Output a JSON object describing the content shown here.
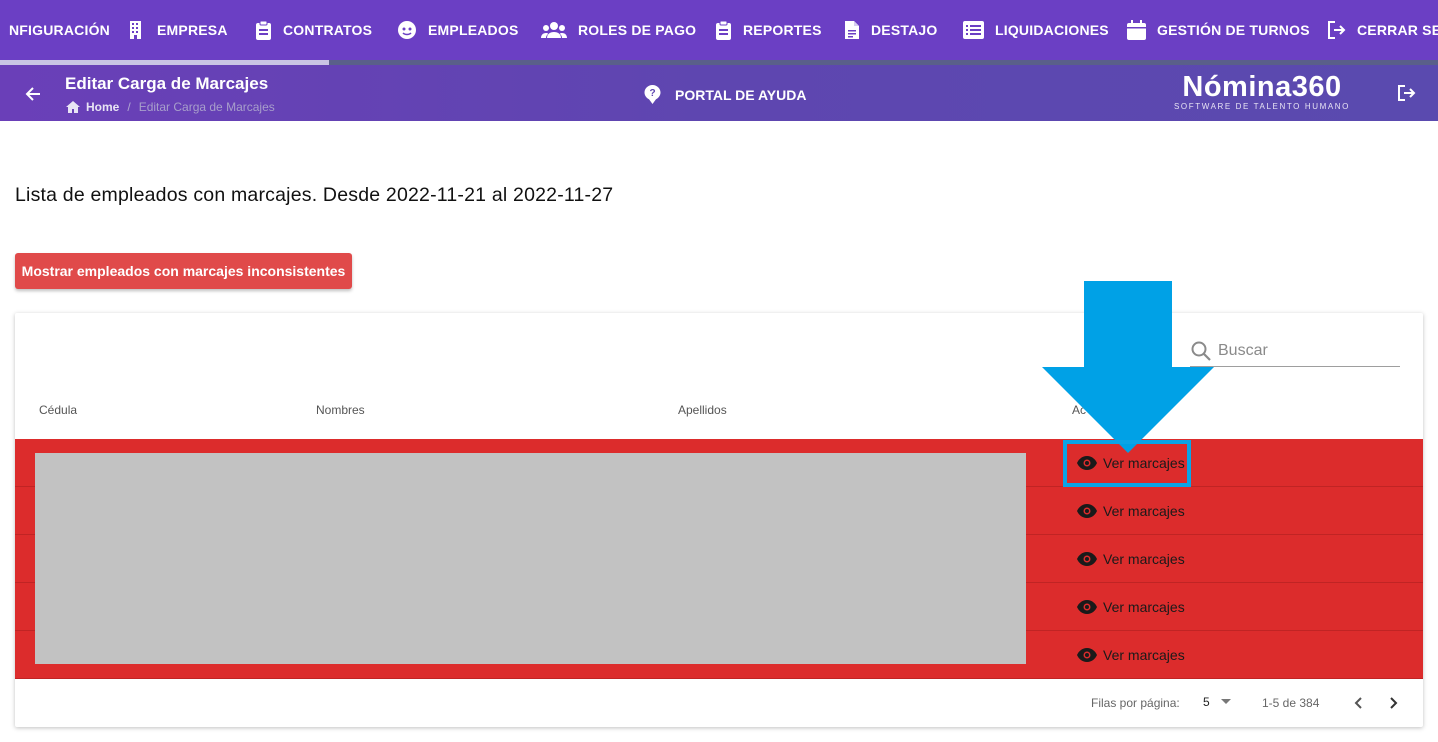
{
  "nav": {
    "items": [
      {
        "label": "NFIGURACIÓN",
        "icon": "gear-icon"
      },
      {
        "label": "EMPRESA",
        "icon": "building-icon"
      },
      {
        "label": "CONTRATOS",
        "icon": "clipboard-icon"
      },
      {
        "label": "EMPLEADOS",
        "icon": "face-icon"
      },
      {
        "label": "ROLES DE PAGO",
        "icon": "group-icon"
      },
      {
        "label": "REPORTES",
        "icon": "clipboard-icon"
      },
      {
        "label": "DESTAJO",
        "icon": "document-icon"
      },
      {
        "label": "LIQUIDACIONES",
        "icon": "list-icon"
      },
      {
        "label": "GESTIÓN DE TURNOS",
        "icon": "calendar-icon"
      },
      {
        "label": "CERRAR SE",
        "icon": "logout-icon"
      }
    ]
  },
  "header": {
    "title": "Editar Carga de Marcajes",
    "breadcrumb": {
      "home": "Home",
      "current": "Editar Carga de Marcajes"
    },
    "help": "PORTAL DE AYUDA",
    "logo": {
      "main": "Nómina360",
      "sub": "SOFTWARE DE TALENTO HUMANO"
    }
  },
  "content": {
    "list_title": "Lista de empleados con marcajes. Desde 2022-11-21 al 2022-11-27",
    "inconsistent_button": "Mostrar empleados con marcajes inconsistentes"
  },
  "table": {
    "search_placeholder": "Buscar",
    "headers": {
      "cedula": "Cédula",
      "nombres": "Nombres",
      "apellidos": "Apellidos",
      "acciones": "Ac"
    },
    "rows": [
      {
        "action": "Ver marcajes"
      },
      {
        "action": "Ver marcajes"
      },
      {
        "action": "Ver marcajes"
      },
      {
        "action": "Ver marcajes"
      },
      {
        "action": "Ver marcajes"
      }
    ],
    "row_color": "#dc2c2c",
    "footer": {
      "rows_per_page_label": "Filas por página:",
      "rows_per_page": "5",
      "range": "1-5 de 384"
    }
  },
  "colors": {
    "nav": "#6b3fc4",
    "button": "#e04a4a",
    "annotation": "#0ba4e6"
  }
}
